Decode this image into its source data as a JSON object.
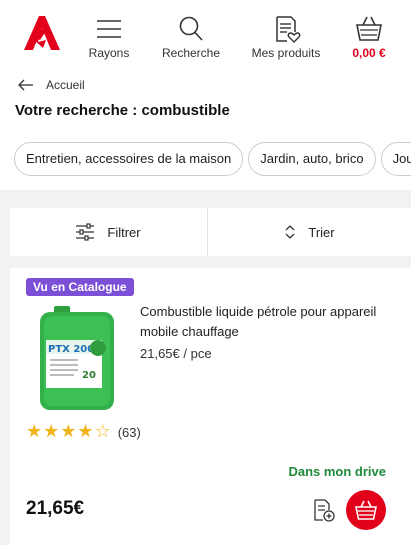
{
  "nav": {
    "logo_icon": "auchan-bird-logo-icon",
    "items": [
      {
        "label": "Rayons",
        "icon": "hamburger-menu-icon"
      },
      {
        "label": "Recherche",
        "icon": "search-icon"
      },
      {
        "label": "Mes produits",
        "icon": "list-heart-icon"
      },
      {
        "label": "0,00 €",
        "icon": "basket-icon"
      }
    ],
    "brand_color": "#e2001a"
  },
  "breadcrumb": {
    "label": "Accueil",
    "icon": "back-arrow-icon"
  },
  "page_title": "Votre recherche : combustible",
  "chips": [
    "Entretien, accessoires de la maison",
    "Jardin, auto, brico",
    "Jouets"
  ],
  "filterbar": {
    "filter_label": "Filtrer",
    "filter_icon": "sliders-icon",
    "sort_label": "Trier",
    "sort_icon": "sort-chevrons-icon"
  },
  "product": {
    "badge": "Vu en Catalogue",
    "badge_color": "#7b4fd6",
    "title": "Combustible liquide pétrole pour appareil mobile chauffage",
    "unit_price": "21,65€ / pce",
    "rating": 4,
    "rating_max": 5,
    "rating_count": "(63)",
    "availability": "Dans mon drive",
    "availability_color": "#1e8a3a",
    "price": "21,65€",
    "image_label": "PTX 2000",
    "image_volume": "20"
  }
}
